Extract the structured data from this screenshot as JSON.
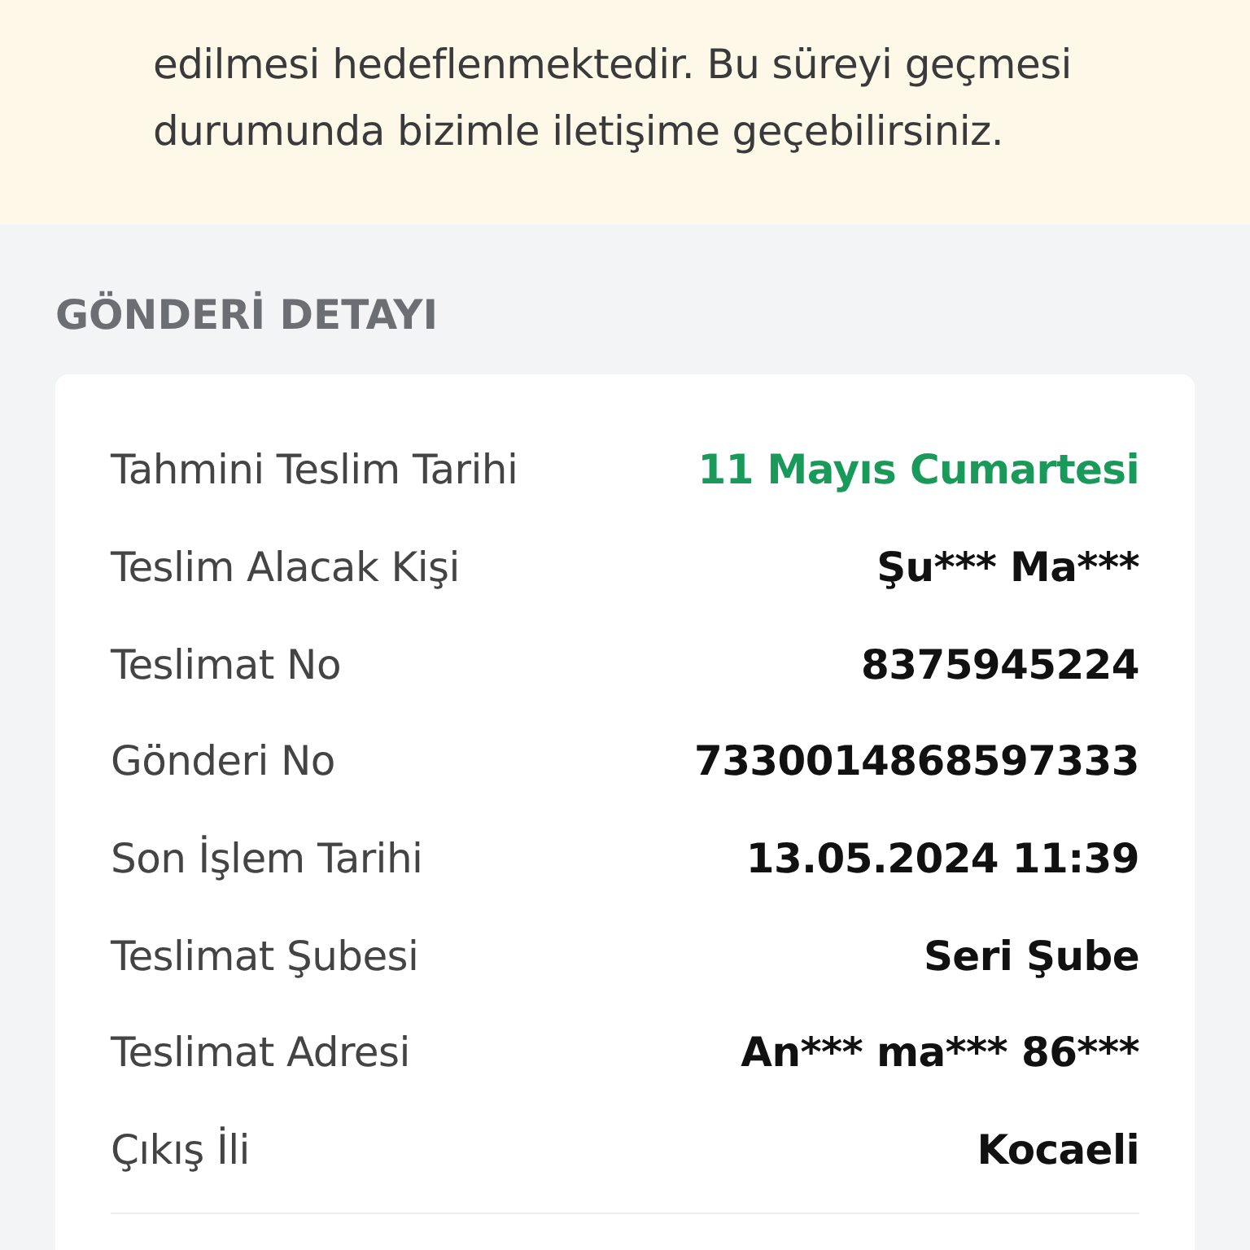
{
  "notice": {
    "text": "edilmesi hedeflenmektedir. Bu süreyi geçmesi durumunda bizimle iletişime geçebilirsiniz."
  },
  "section_title": "GÖNDERİ DETAYI",
  "details": [
    {
      "label": "Tahmini Teslim Tarihi",
      "value": "11 Mayıs Cumartesi",
      "highlight": true
    },
    {
      "label": "Teslim Alacak Kişi",
      "value": "Şu*** Ma***",
      "highlight": false
    },
    {
      "label": "Teslimat No",
      "value": "8375945224",
      "highlight": false
    },
    {
      "label": "Gönderi No",
      "value": "7330014868597333",
      "highlight": false
    },
    {
      "label": "Son İşlem Tarihi",
      "value": "13.05.2024 11:39",
      "highlight": false
    },
    {
      "label": "Teslimat Şubesi",
      "value": "Seri Şube",
      "highlight": false
    },
    {
      "label": "Teslimat Adresi",
      "value": "An*** ma*** 86***",
      "highlight": false
    },
    {
      "label": "Çıkış İli",
      "value": "Kocaeli",
      "highlight": false
    }
  ]
}
